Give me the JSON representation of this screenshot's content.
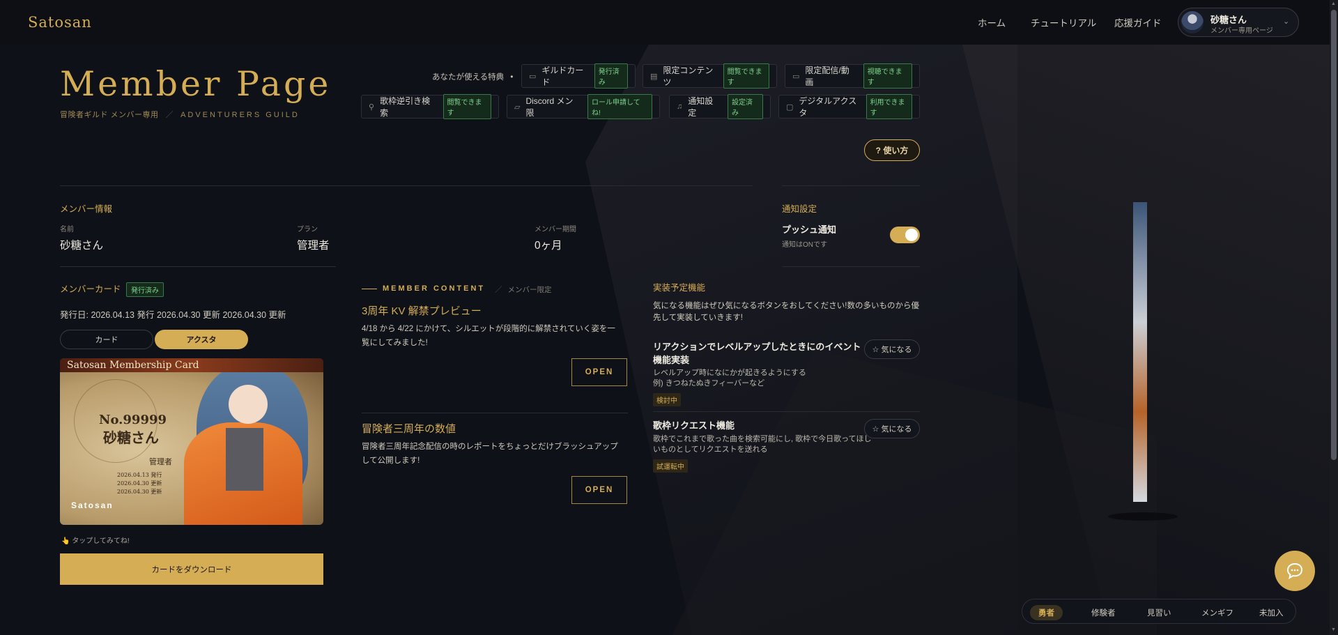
{
  "header": {
    "logo": "Satosan",
    "nav": [
      "ホーム",
      "チュートリアル",
      "応援ガイド"
    ],
    "user": {
      "name": "砂糖さん",
      "subtitle": "メンバー専用ページ",
      "caret": "⌄"
    }
  },
  "title": {
    "main": "Member Page",
    "sub_jp": "冒険者ギルド メンバー専用",
    "sep": "／",
    "sub_en": "ADVENTURERS GUILD"
  },
  "perks": {
    "label": "あなたが使える特典",
    "dot": "•",
    "items": [
      {
        "icon": "card-icon",
        "glyph": "▭",
        "name": "ギルドカード",
        "status": "発行済み"
      },
      {
        "icon": "list-icon",
        "glyph": "▤",
        "name": "限定コンテンツ",
        "status": "閲覧できます"
      },
      {
        "icon": "video-icon",
        "glyph": "▭",
        "name": "限定配信/動画",
        "status": "視聴できます"
      },
      {
        "icon": "search-icon",
        "glyph": "⚲",
        "name": "歌枠逆引き検索",
        "status": "閲覧できます"
      },
      {
        "icon": "discord-icon",
        "glyph": "▱",
        "name": "Discord メン限",
        "status": "ロール申請してね!"
      },
      {
        "icon": "bell-icon",
        "glyph": "♫",
        "name": "通知設定",
        "status": "設定済み"
      },
      {
        "icon": "lock-icon",
        "glyph": "▢",
        "name": "デジタルアクスタ",
        "status": "利用できます"
      }
    ],
    "help_label": "? 使い方"
  },
  "member_info": {
    "title": "メンバー情報",
    "fields": [
      {
        "label": "名前",
        "value": "砂糖さん"
      },
      {
        "label": "プラン",
        "value": "管理者"
      },
      {
        "label": "メンバー期間",
        "value": "0ヶ月"
      }
    ]
  },
  "notify": {
    "title": "通知設定",
    "push_label": "プッシュ通知",
    "push_sub": "通知はONです",
    "enabled": true
  },
  "member_card": {
    "title": "メンバーカード",
    "badge": "発行済み",
    "issue_line": "発行日: 2026.04.13 発行 2026.04.30 更新 2026.04.30 更新",
    "tabs": [
      "カード",
      "アクスタ"
    ],
    "active_tab": 1,
    "card": {
      "header": "Satosan Membership Card",
      "number": "No.99999",
      "name": "砂糖さん",
      "role": "管理者",
      "dates": [
        "2026.04.13 発行",
        "2026.04.30 更新",
        "2026.04.30 更新"
      ],
      "brand": "Satosan"
    },
    "tap_hint": "👆 タップしてみてね!",
    "download_label": "カードをダウンロード"
  },
  "member_content": {
    "heading": "MEMBER CONTENT",
    "sep": "／",
    "limited": "メンバー限定",
    "articles": [
      {
        "title": "3周年 KV 解禁プレビュー",
        "body": "4/18 から 4/22 にかけて、シルエットが段階的に解禁されていく姿を一覧にしてみました!",
        "button": "OPEN"
      },
      {
        "title": "冒険者三周年の数値",
        "body": "冒険者三周年記念配信の時のレポートをちょっとだけブラッシュアップして公開します!",
        "button": "OPEN"
      }
    ]
  },
  "feature_requests": {
    "title": "実装予定機能",
    "intro": "気になる機能はぜひ気になるボタンをおしてください!数の多いものから優先して実装していきます!",
    "items": [
      {
        "title": "リアクションでレベルアップしたときにのイベント機能実装",
        "desc": "レベルアップ時になにかが起きるようにする\n例) きつねたぬきフィーバーなど",
        "status": "検討中",
        "button": "☆ 気になる"
      },
      {
        "title": "歌枠リクエスト機能",
        "desc": "歌枠でこれまで歌った曲を検索可能にし, 歌枠で今日歌ってほしいものとしてリクエストを送れる",
        "status": "試運転中",
        "button": "☆ 気になる"
      }
    ]
  },
  "rank_bar": {
    "items": [
      "勇者",
      "修験者",
      "見習い",
      "メンギフ",
      "未加入"
    ],
    "active": 0
  },
  "colors": {
    "accent": "#d4ad55",
    "background": "#0f1118",
    "badge_green": "#7fd08c"
  }
}
